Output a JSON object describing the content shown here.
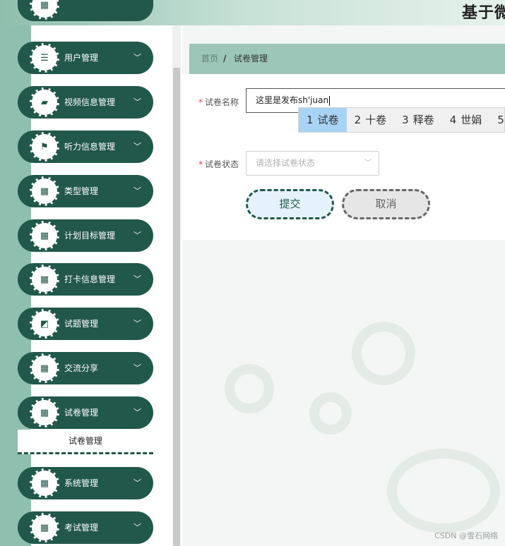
{
  "header": {
    "title": "基于微"
  },
  "sidebar": {
    "items": [
      {
        "label": "",
        "icon": "grid-icon"
      },
      {
        "label": "用户管理",
        "icon": "list-icon"
      },
      {
        "label": "视频信息管理",
        "icon": "video-icon"
      },
      {
        "label": "听力信息管理",
        "icon": "flag-icon"
      },
      {
        "label": "类型管理",
        "icon": "grid-icon"
      },
      {
        "label": "计划目标管理",
        "icon": "grid-icon"
      },
      {
        "label": "打卡信息管理",
        "icon": "grid-icon"
      },
      {
        "label": "试题管理",
        "icon": "chart-icon"
      },
      {
        "label": "交流分享",
        "icon": "grid-icon"
      },
      {
        "label": "试卷管理",
        "icon": "grid-icon"
      },
      {
        "label": "系统管理",
        "icon": "grid-icon"
      },
      {
        "label": "考试管理",
        "icon": "grid-icon"
      }
    ],
    "submenu": {
      "label": "试卷管理"
    }
  },
  "breadcrumb": {
    "home": "首页",
    "separator": "/",
    "current": "试卷管理"
  },
  "form": {
    "name_label": "试卷名称",
    "name_value": "这里是发布sh'juan",
    "status_label": "试卷状态",
    "status_placeholder": "请选择试卷状态",
    "submit_label": "提交",
    "cancel_label": "取消",
    "required_mark": "*"
  },
  "ime": {
    "candidates": [
      {
        "num": "1",
        "text": "试卷"
      },
      {
        "num": "2",
        "text": "十卷"
      },
      {
        "num": "3",
        "text": "释卷"
      },
      {
        "num": "4",
        "text": "世娟"
      },
      {
        "num": "5",
        "text": ""
      }
    ]
  },
  "watermark": "CSDN @雪石网络",
  "colors": {
    "accent": "#22584a",
    "sidebar_bg": "#8fbfae",
    "breadcrumb_bg": "#9cc6b7",
    "ime_selected": "#a8d3f5"
  }
}
